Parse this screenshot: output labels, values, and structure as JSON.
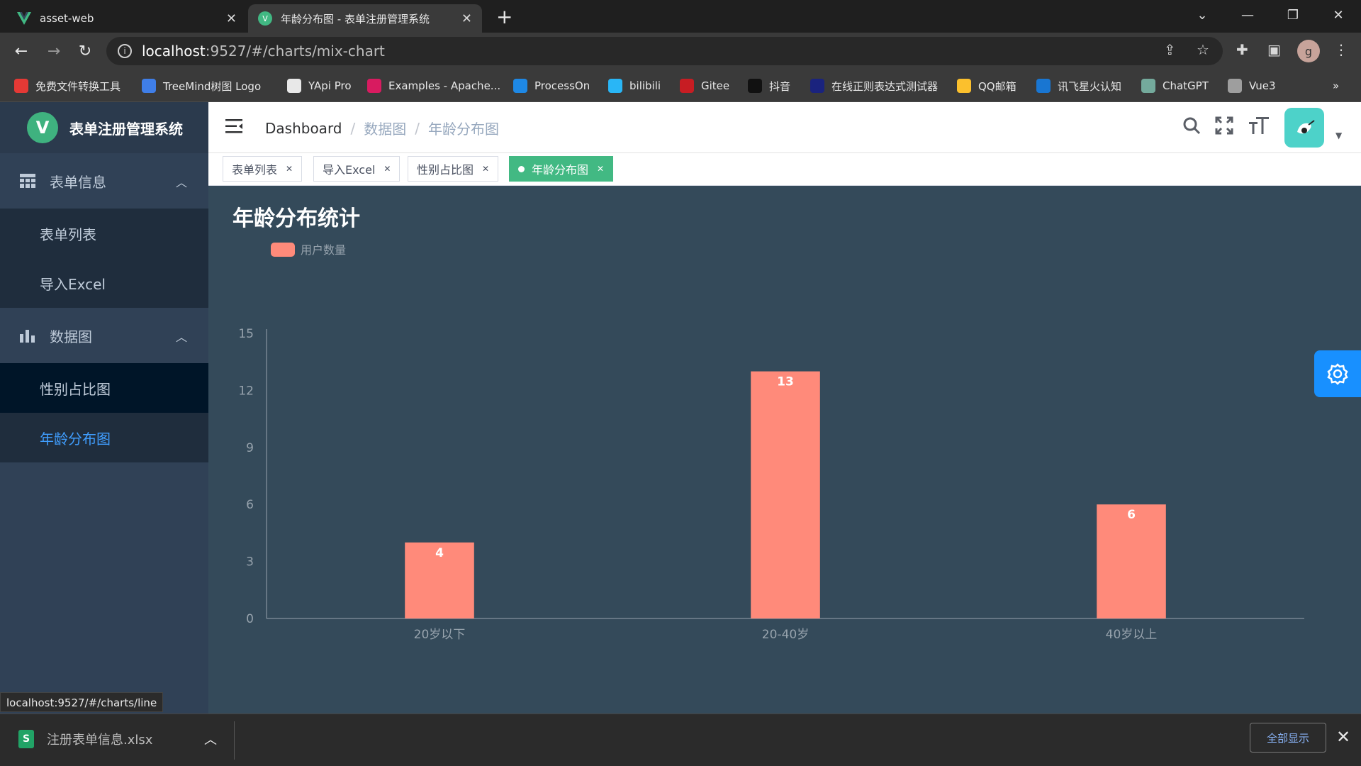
{
  "browser": {
    "tabs": [
      {
        "title": "asset-web",
        "active": false
      },
      {
        "title": "年龄分布图 - 表单注册管理系统",
        "active": true
      }
    ],
    "url_host": "localhost",
    "url_path": ":9527/#/charts/mix-chart",
    "profile_initial": "g",
    "bookmarks": [
      {
        "label": "免费文件转换工具",
        "icon": "convert-icon",
        "color": "#e53935"
      },
      {
        "label": "TreeMind树图 Logo",
        "icon": "treemind-icon",
        "color": "#3f7ee8"
      },
      {
        "label": "YApi Pro",
        "icon": "yapi-icon",
        "color": "#e8e8e8"
      },
      {
        "label": "Examples - Apache...",
        "icon": "echarts-icon",
        "color": "#d81b60"
      },
      {
        "label": "ProcessOn",
        "icon": "processon-icon",
        "color": "#1e88e5"
      },
      {
        "label": "bilibili",
        "icon": "bilibili-icon",
        "color": "#29b6f6"
      },
      {
        "label": "Gitee",
        "icon": "gitee-icon",
        "color": "#c71d23"
      },
      {
        "label": "抖音",
        "icon": "douyin-icon",
        "color": "#111111"
      },
      {
        "label": "在线正则表达式测试器",
        "icon": "regex-icon",
        "color": "#1a237e"
      },
      {
        "label": "QQ邮箱",
        "icon": "qqmail-icon",
        "color": "#fbc02d"
      },
      {
        "label": "讯飞星火认知",
        "icon": "spark-icon",
        "color": "#1976d2"
      },
      {
        "label": "ChatGPT",
        "icon": "chatgpt-icon",
        "color": "#74aa9c"
      },
      {
        "label": "Vue3",
        "icon": "vue3-icon",
        "color": "#9e9e9e"
      }
    ],
    "status_url": "localhost:9527/#/charts/line",
    "download": {
      "filename": "注册表单信息.xlsx",
      "show_all": "全部显示"
    }
  },
  "app": {
    "title": "表单注册管理系统",
    "sidebar": {
      "groups": [
        {
          "label": "表单信息",
          "items": [
            "表单列表",
            "导入Excel"
          ]
        },
        {
          "label": "数据图",
          "items": [
            "性别占比图",
            "年龄分布图"
          ]
        }
      ]
    },
    "breadcrumb": [
      "Dashboard",
      "数据图",
      "年龄分布图"
    ],
    "tags": [
      {
        "label": "表单列表",
        "active": false
      },
      {
        "label": "导入Excel",
        "active": false
      },
      {
        "label": "性别占比图",
        "active": false
      },
      {
        "label": "年龄分布图",
        "active": true
      }
    ]
  },
  "chart_data": {
    "type": "bar",
    "title": "年龄分布统计",
    "legend": "用户数量",
    "legend_placement": "top-left",
    "categories": [
      "20岁以下",
      "20-40岁",
      "40岁以上"
    ],
    "values": [
      4,
      13,
      6
    ],
    "yticks": [
      "0",
      "3",
      "6",
      "9",
      "12",
      "15"
    ],
    "ylim": [
      0,
      15
    ],
    "bar_color": "#ff8a7a",
    "background": "#344a5a"
  }
}
